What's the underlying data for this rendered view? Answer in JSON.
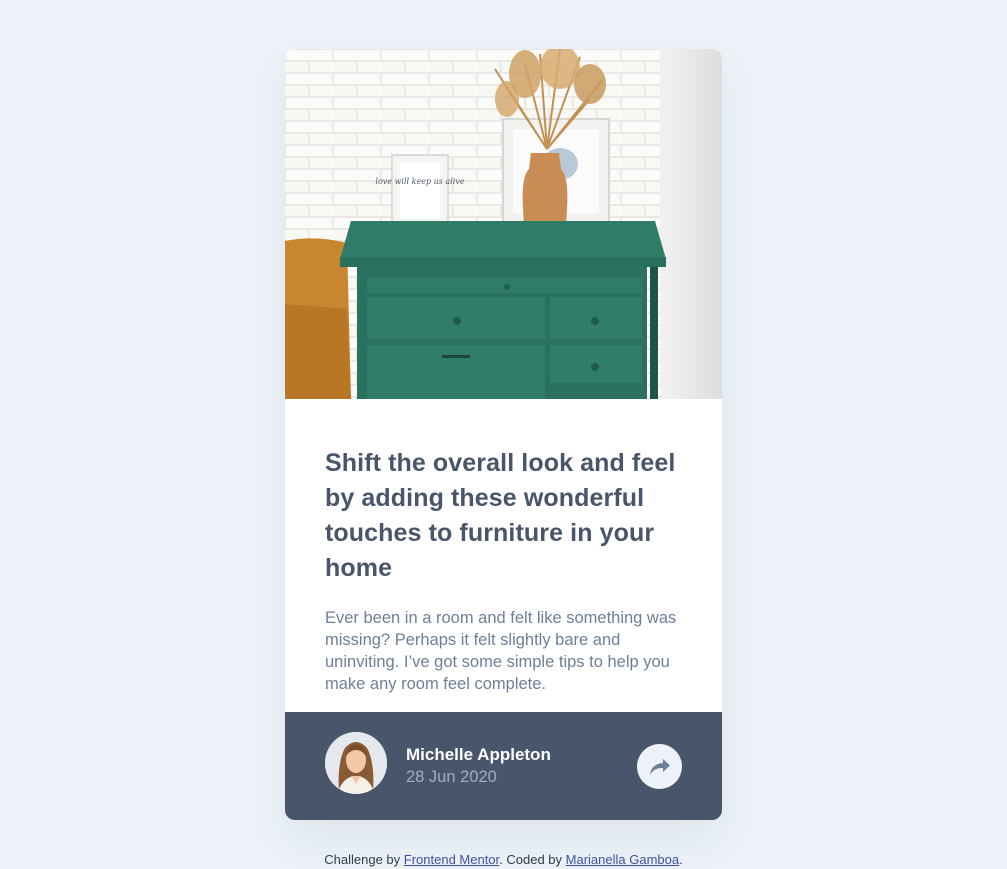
{
  "article": {
    "title": "Shift the overall look and feel by adding these wonderful touches to furniture in your home",
    "description": "Ever been in a room and felt like something was missing? Perhaps it felt slightly bare and uninviting. I’ve got some simple tips to help you make any room feel complete.",
    "frame_text": "love will keep us alive"
  },
  "author": {
    "name": "Michelle Appleton",
    "date": "28 Jun 2020"
  },
  "attribution": {
    "prefix": "Challenge by",
    "frontend_mentor": "Frontend Mentor",
    "middle": ". Coded by",
    "coder": "Marianella Gamboa",
    "suffix": "."
  },
  "icons": {
    "share": "share-arrow-icon"
  },
  "colors": {
    "background": "#ecf2f8",
    "title": "#48556a",
    "body": "#6e8098",
    "footer": "#48556a",
    "muted": "#9eafc2",
    "link": "#3e52a3"
  }
}
